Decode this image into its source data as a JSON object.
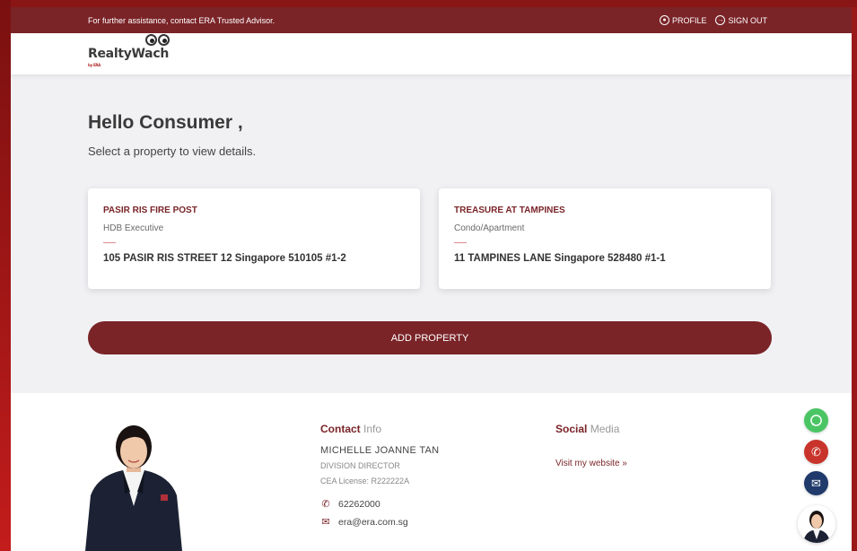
{
  "topbar": {
    "assistance_text": "For further assistance, contact ERA Trusted Advisor.",
    "profile_label": "PROFILE",
    "signout_label": "SIGN OUT"
  },
  "logo": {
    "text": "RealtyWa",
    "text_end": "ch",
    "sub": "by ERA"
  },
  "main": {
    "greeting": "Hello Consumer ,",
    "instruction": "Select a property to view details."
  },
  "properties": [
    {
      "name": "PASIR RIS FIRE POST",
      "type": "HDB Executive",
      "address": "105 PASIR RIS STREET 12 Singapore 510105 #1-2"
    },
    {
      "name": "TREASURE AT TAMPINES",
      "type": "Condo/Apartment",
      "address": "11 TAMPINES LANE Singapore 528480 #1-1"
    }
  ],
  "add_property_label": "ADD PROPERTY",
  "footer": {
    "contact_heading_bold": "Contact",
    "contact_heading_rest": " Info",
    "agent_name": "MICHELLE JOANNE TAN",
    "agent_title": "DIVISION DIRECTOR",
    "agent_cea": "CEA License: R222222A",
    "phone": "62262000",
    "email": "era@era.com.sg",
    "social_heading_bold": "Social",
    "social_heading_rest": " Media",
    "website_link": "Visit my website »"
  },
  "colors": {
    "brand": "#7a2428",
    "whatsapp": "#4bc564",
    "call": "#c8342b",
    "mail": "#1f3a6b"
  },
  "icons": {
    "profile": "user-circle-icon",
    "signout": "sign-out-icon",
    "phone": "phone-icon",
    "email": "envelope-icon",
    "whatsapp": "whatsapp-icon"
  }
}
